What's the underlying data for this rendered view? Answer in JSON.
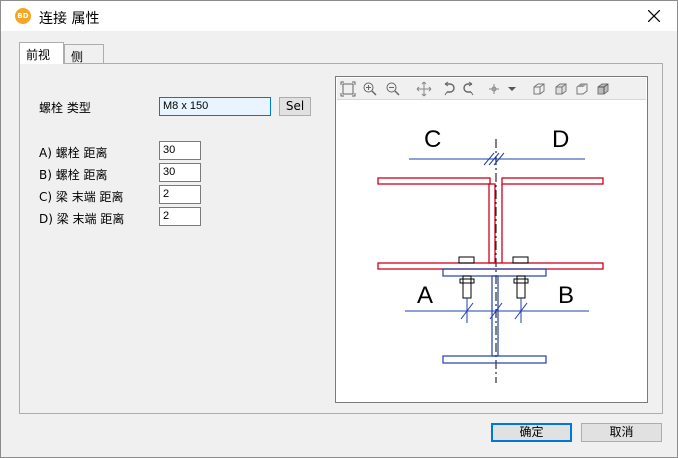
{
  "window": {
    "title": "连接 属性",
    "app_icon_text": "BD",
    "close_icon": "close-icon"
  },
  "tabs": [
    {
      "label": "前视",
      "active": true
    },
    {
      "label": "侧",
      "active": false
    }
  ],
  "form": {
    "bolt_type_label": "螺栓 类型",
    "bolt_type_value": "M8 x 150",
    "sel_button": "Sel",
    "fields": [
      {
        "label": "A) 螺栓 距离",
        "value": "30"
      },
      {
        "label": "B) 螺栓 距离",
        "value": "30"
      },
      {
        "label": "C) 梁 末端 距离",
        "value": "2"
      },
      {
        "label": "D) 梁 末端 距离",
        "value": "2"
      }
    ]
  },
  "preview": {
    "toolbar_icons": [
      "zoom-extents-icon",
      "zoom-in-icon",
      "zoom-out-icon",
      "pan-icon",
      "rotate-left-icon",
      "rotate-right-icon",
      "pointer-icon",
      "dropdown-icon",
      "view-front-icon",
      "view-side-icon",
      "view-top-icon",
      "view-3d-icon"
    ],
    "labels": {
      "a": "A",
      "b": "B",
      "c": "C",
      "d": "D"
    },
    "colors": {
      "beam": "#d0021b",
      "plate": "#1f3fb0",
      "dim": "#1f3fb0",
      "axis": "#000000"
    }
  },
  "footer": {
    "ok_label": "确定",
    "cancel_label": "取消"
  }
}
